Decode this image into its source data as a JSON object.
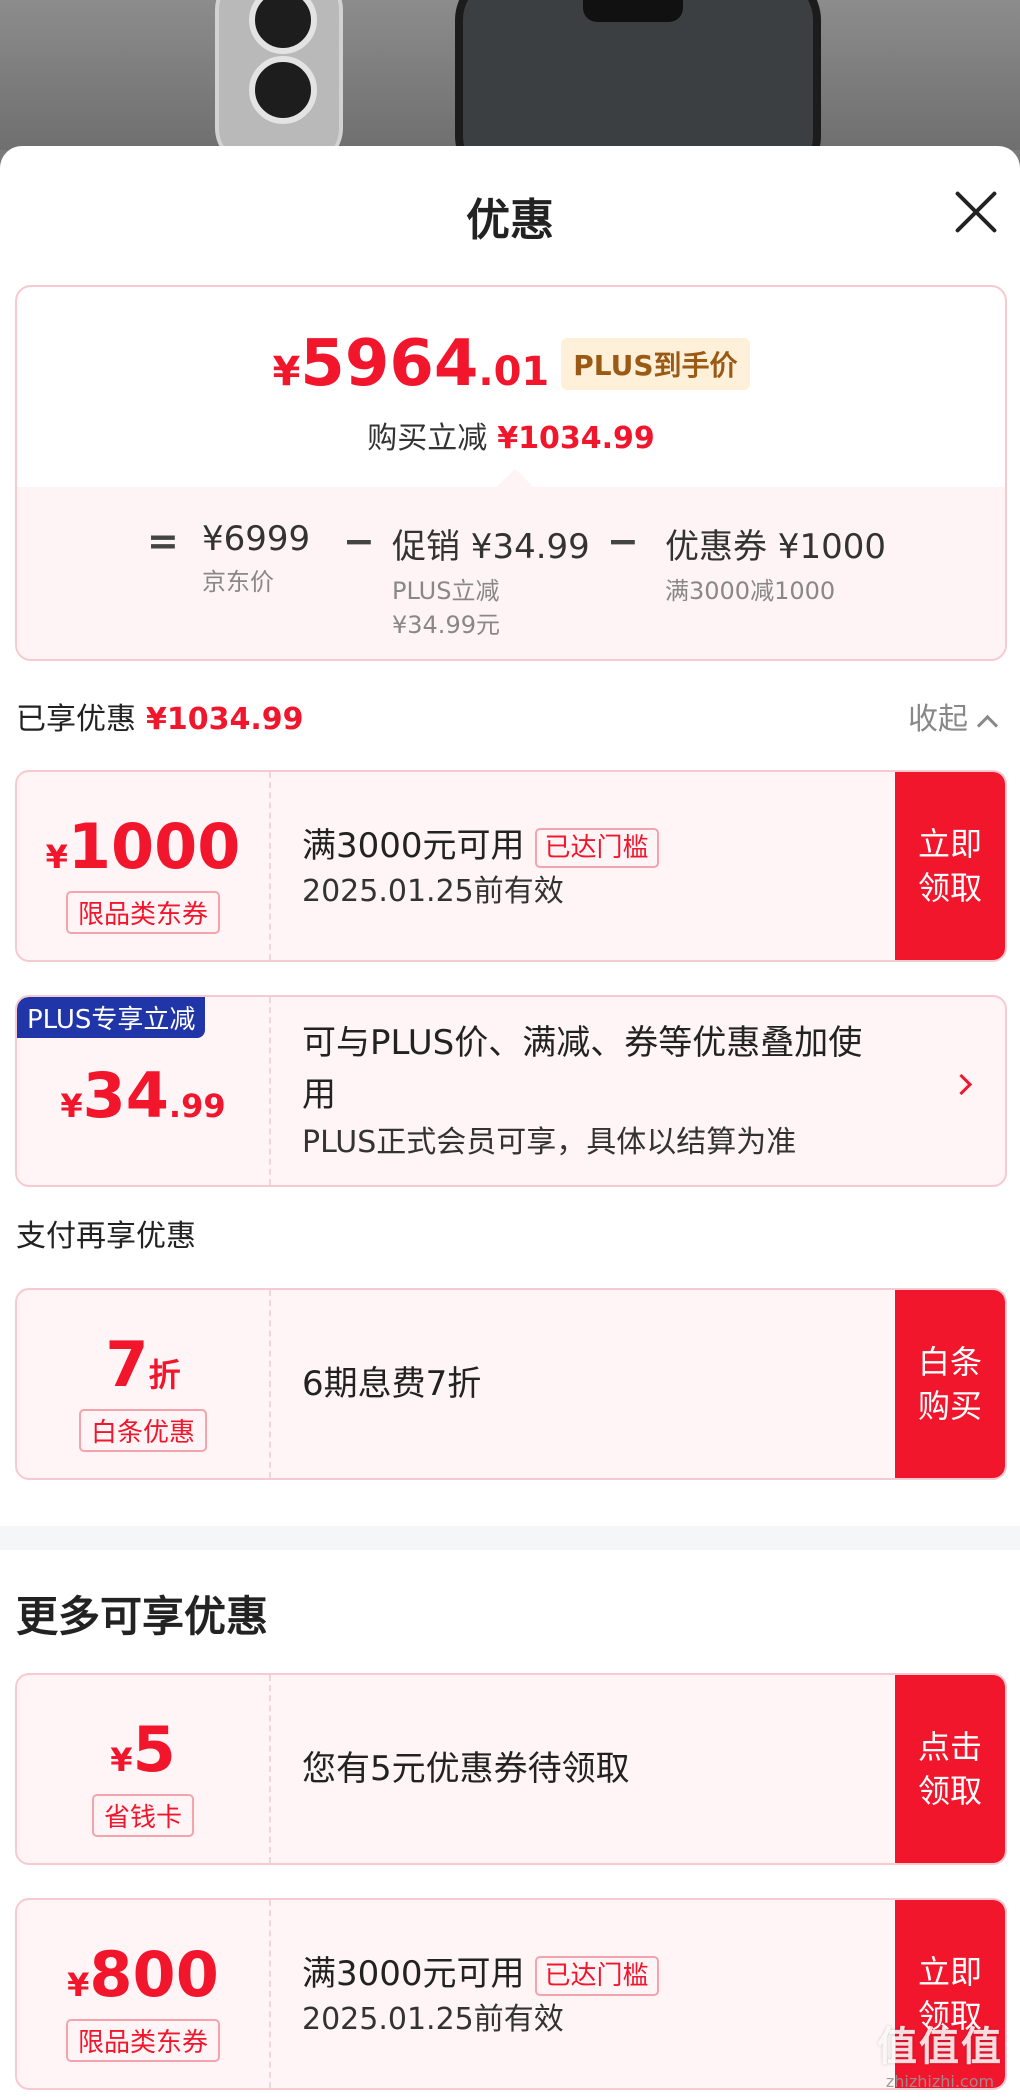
{
  "sheet": {
    "title": "优惠"
  },
  "summary": {
    "final_price": {
      "currency": "¥",
      "integer": "5964",
      "decimal": ".01"
    },
    "plus_badge": "PLUS到手价",
    "buy_reduce_label": "购买立减",
    "buy_reduce_amount": "¥1034.99",
    "formula": {
      "equals": "=",
      "minus": "−",
      "jd_price": {
        "value": "¥6999",
        "label": "京东价"
      },
      "promo": {
        "value": "促销 ¥34.99",
        "label1": "PLUS立减",
        "label2": "¥34.99元"
      },
      "coupon": {
        "value": "优惠券 ¥1000",
        "label": "满3000减1000"
      }
    }
  },
  "enjoyed": {
    "label": "已享优惠",
    "amount": "¥1034.99",
    "collapse": "收起"
  },
  "coupons": [
    {
      "currency": "¥",
      "amount": "1000",
      "tag": "限品类东券",
      "title": "满3000元可用",
      "reached": "已达门槛",
      "validity": "2025.01.25前有效",
      "button": "立即领取"
    },
    {
      "corner": "PLUS专享立减",
      "currency": "¥",
      "amount": "34",
      "decimal": ".99",
      "title": "可与PLUS价、满减、券等优惠叠加使用",
      "desc": "PLUS正式会员可享，具体以结算为准"
    }
  ],
  "pay_section": {
    "label": "支付再享优惠",
    "item": {
      "amount": "7",
      "unit": "折",
      "tag": "白条优惠",
      "title": "6期息费7折",
      "button": "白条购买"
    }
  },
  "more_section": {
    "title": "更多可享优惠",
    "items": [
      {
        "currency": "¥",
        "amount": "5",
        "tag": "省钱卡",
        "title": "您有5元优惠券待领取",
        "button": "点击领取"
      },
      {
        "currency": "¥",
        "amount": "800",
        "tag": "限品类东券",
        "title": "满3000元可用",
        "reached": "已达门槛",
        "validity": "2025.01.25前有效",
        "button": "立即领取"
      }
    ]
  },
  "watermark": {
    "logo": "值值值",
    "site": "zhizhizhi.com"
  }
}
